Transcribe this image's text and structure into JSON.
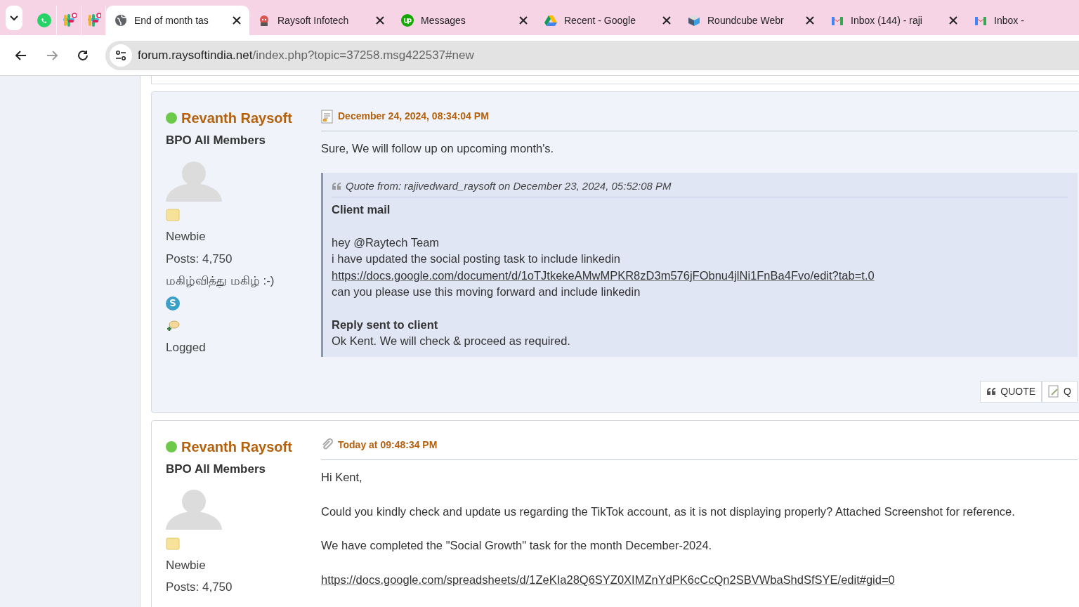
{
  "browser": {
    "tabs": [
      {
        "kind": "pinned",
        "selected": false
      },
      {
        "kind": "pinned",
        "selected": false
      },
      {
        "kind": "pinned",
        "selected": false
      },
      {
        "kind": "normal",
        "title": "End of month tas",
        "selected": true
      },
      {
        "kind": "normal",
        "title": "Raysoft Infotech",
        "selected": false
      },
      {
        "kind": "normal",
        "title": "Messages",
        "selected": false
      },
      {
        "kind": "normal",
        "title": "Recent - Google",
        "selected": false
      },
      {
        "kind": "normal",
        "title": "Roundcube Webr",
        "selected": false
      },
      {
        "kind": "normal",
        "title": "Inbox (144) - raji",
        "selected": false
      },
      {
        "kind": "normal",
        "title": "Inbox -",
        "selected": false
      }
    ],
    "address": {
      "host": "forum.raysoftindia.net",
      "path": "/index.php?topic=37258.msg422537#new"
    }
  },
  "posts": [
    {
      "author": "Revanth Raysoft",
      "online": true,
      "group": "BPO All Members",
      "rank": "Newbie",
      "post_count": "Posts: 4,750",
      "signature": "மகிழ்வித்து மகிழ் :-)",
      "status": "Logged",
      "date": "December 24, 2024, 08:34:04 PM",
      "attachment": false,
      "body": [
        {
          "kind": "text",
          "text": "Sure, We will follow up on upcoming month's."
        },
        {
          "kind": "quote",
          "header": "Quote from: rajivedward_raysoft on December 23, 2024, 05:52:08 PM",
          "lines": [
            {
              "kind": "bold",
              "text": "Client mail"
            },
            {
              "kind": "blank"
            },
            {
              "kind": "text",
              "text": "hey @Raytech Team"
            },
            {
              "kind": "text",
              "text": "i have updated the social posting task to include linkedin"
            },
            {
              "kind": "link",
              "text": "https://docs.google.com/document/d/1oTJtkekeAMwMPKR8zD3m576jFObnu4jlNi1FnBa4Fvo/edit?tab=t.0"
            },
            {
              "kind": "text",
              "text": "can you please use this moving forward and include linkedin"
            },
            {
              "kind": "blank"
            },
            {
              "kind": "bold",
              "text": "Reply sent to client"
            },
            {
              "kind": "text",
              "text": "Ok Kent. We will check & proceed as required."
            }
          ]
        }
      ],
      "buttons": [
        "QUOTE",
        "Q"
      ]
    },
    {
      "author": "Revanth Raysoft",
      "online": true,
      "group": "BPO All Members",
      "rank": "Newbie",
      "post_count": "Posts: 4,750",
      "date": "Today at 09:48:34 PM",
      "attachment": true,
      "body": [
        {
          "kind": "text",
          "text": "Hi Kent,"
        },
        {
          "kind": "text",
          "text": "Could you kindly check and update us regarding the TikTok account, as it is not displaying properly? Attached Screenshot for reference."
        },
        {
          "kind": "text",
          "text": "We have completed the \"Social Growth\" task for the month December-2024."
        },
        {
          "kind": "link",
          "text": "https://docs.google.com/spreadsheets/d/1ZeKIa28Q6SYZ0XIMZnYdPK6cCcQn2SBVWbaShdSfSYE/edit#gid=0"
        }
      ]
    }
  ]
}
